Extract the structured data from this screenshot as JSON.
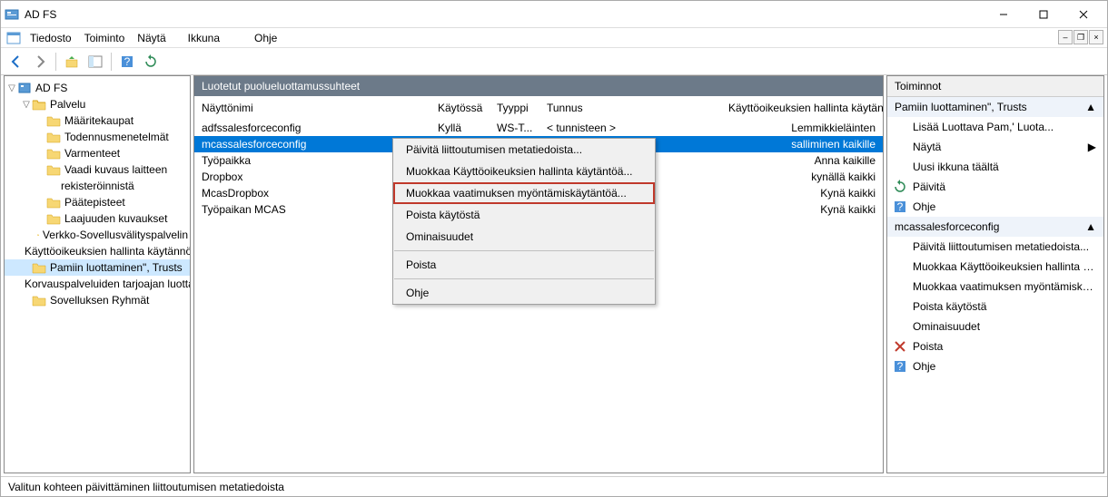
{
  "window": {
    "title": "AD FS"
  },
  "menubar": {
    "items": [
      "Tiedosto",
      "Toiminto",
      "Näytä",
      "Ikkuna",
      "Ohje"
    ]
  },
  "tree": {
    "root": "AD FS",
    "service": "Palvelu",
    "service_children": [
      "Määritekaupat",
      "Todennusmenetelmät",
      "Varmenteet",
      "Vaadi kuvaus laitteen",
      "rekisteröinnistä",
      "Päätepisteet",
      "Laajuuden kuvaukset",
      "Verkko-Sovellusvälityspalvelin"
    ],
    "other": [
      "Käyttöoikeuksien hallinta käytännöt",
      "Pamiin luottaminen\", Trusts",
      "Korvauspalveluiden tarjoajan luottamus",
      "Sovelluksen Ryhmät"
    ]
  },
  "content": {
    "header": "Luotetut puolueluottamussuhteet",
    "columns": {
      "name": "Näyttönimi",
      "enabled": "Käytössä",
      "type": "Tyyppi",
      "id": "Tunnus",
      "access": "Käyttöoikeuksien hallinta käytäntö"
    },
    "rows": [
      {
        "name": "adfssalesforceconfig",
        "enabled": "Kyllä",
        "type": "WS-T...",
        "id": "< tunnisteen &gt",
        "access": "Lemmikkieläinten"
      },
      {
        "name": "mcassalesforceconfig",
        "enabled": "",
        "type": "",
        "id": "",
        "access": "salliminen kaikille",
        "selected": true
      },
      {
        "name": "Työpaikka",
        "enabled": "",
        "type": "",
        "id": "",
        "access": "Anna kaikille"
      },
      {
        "name": "Dropbox",
        "enabled": "",
        "type": "",
        "id": "",
        "access": "kynällä kaikki"
      },
      {
        "name": "McasDropbox",
        "enabled": "",
        "type": "",
        "id": "",
        "access": "Kynä kaikki"
      },
      {
        "name": "Työpaikan MCAS",
        "enabled": "",
        "type": "",
        "id": "",
        "access": "Kynä kaikki"
      }
    ]
  },
  "context_menu": {
    "items": [
      {
        "label": "Päivitä liittoutumisen metatiedoista...",
        "type": "item"
      },
      {
        "label": "Muokkaa Käyttöoikeuksien hallinta käytäntöä...",
        "type": "item"
      },
      {
        "label": "Muokkaa vaatimuksen myöntämiskäytäntöä...",
        "type": "item",
        "highlighted": true
      },
      {
        "label": "Poista käytöstä",
        "type": "item"
      },
      {
        "label": "Ominaisuudet",
        "type": "item"
      },
      {
        "type": "sep"
      },
      {
        "label": "Poista",
        "type": "item"
      },
      {
        "type": "sep"
      },
      {
        "label": "Ohje",
        "type": "item"
      }
    ]
  },
  "actions": {
    "title": "Toiminnot",
    "group1_title": "Pamiin luottaminen\", Trusts",
    "group1_items": [
      {
        "label": "Lisää Luottava Pam,' Luota...",
        "icon": "none"
      },
      {
        "label": "Näytä",
        "icon": "none",
        "arrow": true
      },
      {
        "label": "Uusi ikkuna täältä",
        "icon": "none"
      },
      {
        "label": "Päivitä",
        "icon": "refresh"
      },
      {
        "label": "Ohje",
        "icon": "help"
      }
    ],
    "group2_title": "mcassalesforceconfig",
    "group2_items": [
      {
        "label": "Päivitä liittoutumisen metatiedoista...",
        "icon": "none"
      },
      {
        "label": "Muokkaa Käyttöoikeuksien hallinta käytäntöä...",
        "icon": "none"
      },
      {
        "label": "Muokkaa vaatimuksen myöntämiskäytäntöä...",
        "icon": "none"
      },
      {
        "label": "Poista käytöstä",
        "icon": "none"
      },
      {
        "label": "Ominaisuudet",
        "icon": "none"
      },
      {
        "label": "Poista",
        "icon": "delete"
      },
      {
        "label": "Ohje",
        "icon": "help"
      }
    ]
  },
  "statusbar": {
    "text": "Valitun kohteen päivittäminen liittoutumisen metatiedoista"
  }
}
